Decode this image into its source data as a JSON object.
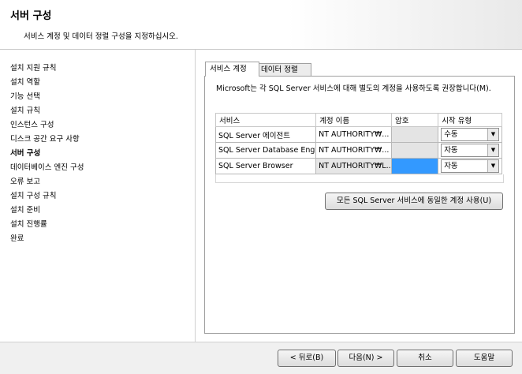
{
  "header": {
    "title": "서버 구성",
    "description": "서비스 계정 및 데이터 정렬 구성을 지정하십시오."
  },
  "sidebar": {
    "steps": [
      "설치 지원 규칙",
      "설치 역할",
      "기능 선택",
      "설치 규칙",
      "인스턴스 구성",
      "디스크 공간 요구 사항",
      "서버 구성",
      "데이터베이스 엔진 구성",
      "오류 보고",
      "설치 구성 규칙",
      "설치 준비",
      "설치 진행률",
      "완료"
    ],
    "current_step": "서버 구성"
  },
  "tabs": [
    {
      "label": "서비스 계정",
      "active": true
    },
    {
      "label": "데이터 정렬",
      "active": false
    }
  ],
  "instruction": "Microsoft는 각 SQL Server 서비스에 대해 별도의 계정을 사용하도록 권장합니다(M).",
  "table": {
    "headers": [
      "서비스",
      "계정 이름",
      "암호",
      "시작 유형"
    ],
    "rows": [
      {
        "service": "SQL Server 에이전트",
        "account": "NT AUTHORITY₩...",
        "password": "",
        "startup": "수동"
      },
      {
        "service": "SQL Server Database Eng...",
        "account": "NT AUTHORITY₩...",
        "password": "",
        "startup": "자동"
      },
      {
        "service": "SQL Server Browser",
        "account": "NT AUTHORITY₩L...",
        "password": "",
        "startup": "자동"
      }
    ],
    "dropdown_arrow": "▼"
  },
  "same_account_button": "모든 SQL Server 서비스에 동일한 계정 사용(U)",
  "footer": {
    "back": "< 뒤로(B)",
    "next": "다음(N) >",
    "cancel": "취소",
    "help": "도움말"
  },
  "colors": {
    "selection": "#3399ff",
    "readonly_cell": "#e4e4e4"
  }
}
